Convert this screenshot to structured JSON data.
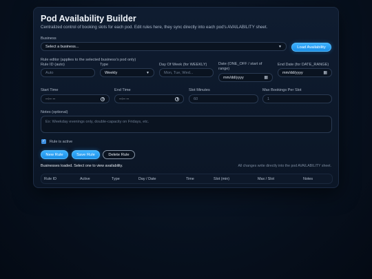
{
  "header": {
    "title": "Pod Availability Builder",
    "subtitle": "Centralized control of booking slots for each pod. Edit rules here, they sync directly into each pod's AVAILABILITY sheet."
  },
  "business": {
    "label": "Business",
    "selected": "Select a business...",
    "load_button": "Load Availability"
  },
  "editor": {
    "heading": "Rule editor (applies to the selected business's pod only)",
    "rule_id": {
      "label": "Rule ID (auto)",
      "placeholder": "Auto"
    },
    "type": {
      "label": "Type",
      "value": "Weekly"
    },
    "day_of_week": {
      "label": "Day Of Week (for WEEKLY)",
      "placeholder": "Mon, Tue, Wed..."
    },
    "date": {
      "label": "Date (ONE_OFF / start of range)",
      "placeholder": "mm/dd/yyyy"
    },
    "end_date": {
      "label": "End Date (for DATE_RANGE)",
      "placeholder": "mm/dd/yyyy"
    },
    "start_time": {
      "label": "Start Time",
      "placeholder": "--:-- --"
    },
    "end_time": {
      "label": "End Time",
      "placeholder": "--:-- --"
    },
    "slot_minutes": {
      "label": "Slot Minutes",
      "placeholder": "60"
    },
    "max_bookings": {
      "label": "Max Bookings Per Slot",
      "placeholder": "1"
    },
    "notes": {
      "label": "Notes (optional)",
      "placeholder": "Ex: Weekday evenings only, double-capacity on Fridays, etc."
    },
    "active": {
      "label": "Rule is active",
      "checked": true
    }
  },
  "actions": {
    "new_rule": "New Rule",
    "save_rule": "Save Rule",
    "delete_rule": "Delete Rule"
  },
  "status": {
    "message": "Businesses loaded. Select one to view availability.",
    "note": "All changes write directly into the pod AVAILABILITY sheet."
  },
  "table": {
    "columns": [
      "Rule ID",
      "Active",
      "Type",
      "Day / Date",
      "Time",
      "Slot (min)",
      "Max / Slot",
      "Notes"
    ]
  },
  "icons": {
    "chevron": "chevron-down-icon",
    "calendar": "calendar-icon",
    "clock": "clock-icon",
    "checkbox": "checkmark-icon"
  },
  "colors": {
    "accent": "#1c8fe6",
    "background": "#07111f",
    "panel": "#0f1c30"
  }
}
